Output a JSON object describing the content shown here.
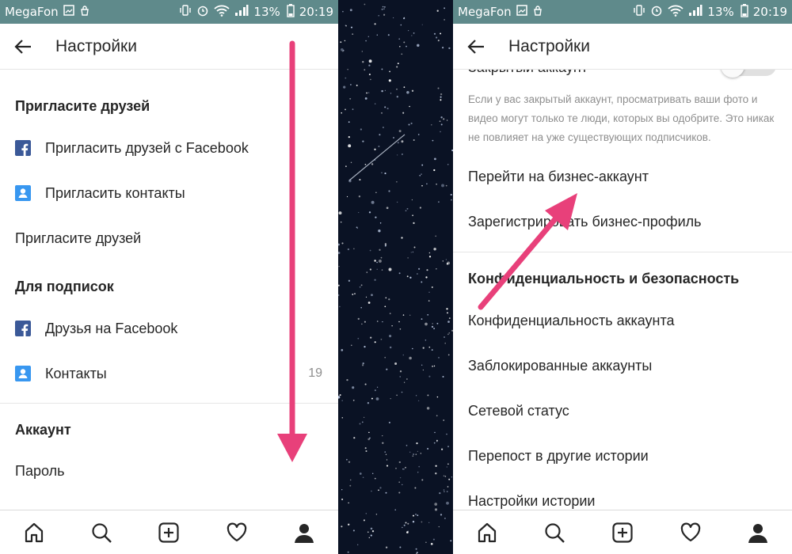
{
  "status_bar": {
    "carrier": "MegaFon",
    "battery": "13%",
    "time": "20:19"
  },
  "left": {
    "title": "Настройки",
    "items": [
      {
        "text": "Пригласите друзей",
        "kind": "section"
      },
      {
        "text": "Пригласить друзей с Facebook",
        "kind": "fb"
      },
      {
        "text": "Пригласить контакты",
        "kind": "contact"
      },
      {
        "text": "Пригласите друзей",
        "kind": "plain"
      },
      {
        "text": "Для подписок",
        "kind": "section"
      },
      {
        "text": "Друзья на Facebook",
        "kind": "fb"
      },
      {
        "text": "Контакты",
        "kind": "contact",
        "count": "19"
      },
      {
        "text": "Аккаунт",
        "kind": "section"
      },
      {
        "text": "Пароль",
        "kind": "plain"
      }
    ]
  },
  "right": {
    "title": "Настройки",
    "partial_label": "Закрытый аккаунт",
    "private_note": "Если у вас закрытый аккаунт, просматривать ваши фото и видео могут только те люди, которых вы одобрите. Это никак не повлияет на уже существующих подписчиков.",
    "items": [
      {
        "text": "Перейти на бизнес-аккаунт",
        "kind": "plain"
      },
      {
        "text": "Зарегистрировать бизнес-профиль",
        "kind": "plain"
      },
      {
        "text": "Конфиденциальность и безопасность",
        "kind": "section"
      },
      {
        "text": "Конфиденциальность аккаунта",
        "kind": "plain"
      },
      {
        "text": "Заблокированные аккаунты",
        "kind": "plain"
      },
      {
        "text": "Сетевой статус",
        "kind": "plain"
      },
      {
        "text": "Перепост в другие истории",
        "kind": "plain"
      },
      {
        "text": "Настройки истории",
        "kind": "plain"
      }
    ]
  },
  "tabbar": {
    "icons": [
      "home-icon",
      "search-icon",
      "add-post-icon",
      "heart-icon",
      "profile-icon"
    ]
  },
  "colors": {
    "status_bar": "#5f8a8b",
    "annotation_arrow": "#e8407a",
    "facebook": "#3b5998",
    "contacts": "#3897f0"
  }
}
